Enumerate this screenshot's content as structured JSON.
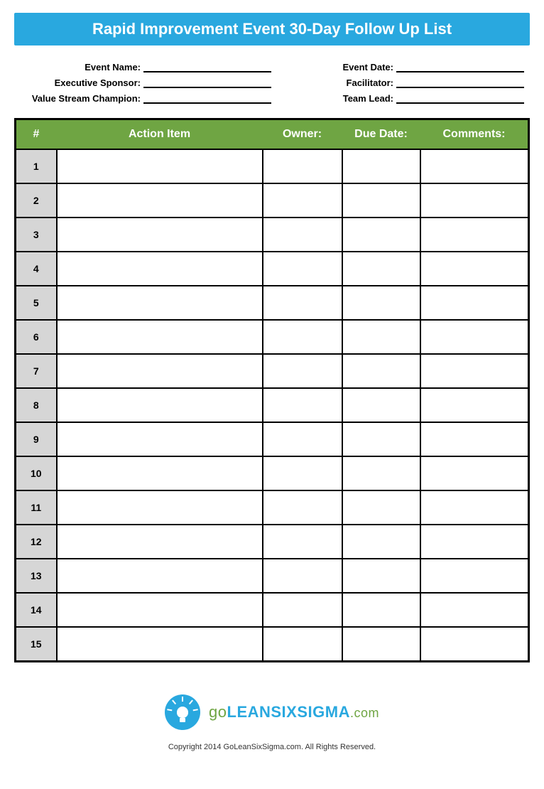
{
  "title": "Rapid Improvement Event 30-Day Follow Up List",
  "meta": {
    "left": [
      {
        "label": "Event Name:",
        "value": ""
      },
      {
        "label": "Executive Sponsor:",
        "value": ""
      },
      {
        "label": "Value Stream Champion:",
        "value": ""
      }
    ],
    "right": [
      {
        "label": "Event Date:",
        "value": ""
      },
      {
        "label": "Facilitator:",
        "value": ""
      },
      {
        "label": "Team Lead:",
        "value": ""
      }
    ]
  },
  "table": {
    "headers": {
      "num": "#",
      "action": "Action Item",
      "owner": "Owner:",
      "due": "Due Date:",
      "comments": "Comments:"
    },
    "rows": [
      {
        "num": "1",
        "action": "",
        "owner": "",
        "due": "",
        "comments": ""
      },
      {
        "num": "2",
        "action": "",
        "owner": "",
        "due": "",
        "comments": ""
      },
      {
        "num": "3",
        "action": "",
        "owner": "",
        "due": "",
        "comments": ""
      },
      {
        "num": "4",
        "action": "",
        "owner": "",
        "due": "",
        "comments": ""
      },
      {
        "num": "5",
        "action": "",
        "owner": "",
        "due": "",
        "comments": ""
      },
      {
        "num": "6",
        "action": "",
        "owner": "",
        "due": "",
        "comments": ""
      },
      {
        "num": "7",
        "action": "",
        "owner": "",
        "due": "",
        "comments": ""
      },
      {
        "num": "8",
        "action": "",
        "owner": "",
        "due": "",
        "comments": ""
      },
      {
        "num": "9",
        "action": "",
        "owner": "",
        "due": "",
        "comments": ""
      },
      {
        "num": "10",
        "action": "",
        "owner": "",
        "due": "",
        "comments": ""
      },
      {
        "num": "11",
        "action": "",
        "owner": "",
        "due": "",
        "comments": ""
      },
      {
        "num": "12",
        "action": "",
        "owner": "",
        "due": "",
        "comments": ""
      },
      {
        "num": "13",
        "action": "",
        "owner": "",
        "due": "",
        "comments": ""
      },
      {
        "num": "14",
        "action": "",
        "owner": "",
        "due": "",
        "comments": ""
      },
      {
        "num": "15",
        "action": "",
        "owner": "",
        "due": "",
        "comments": ""
      }
    ]
  },
  "logo": {
    "go": "go",
    "lean": "LEANSIXSIGMA",
    "dotcom": ".com"
  },
  "copyright": "Copyright 2014 GoLeanSixSigma.com. All Rights Reserved."
}
